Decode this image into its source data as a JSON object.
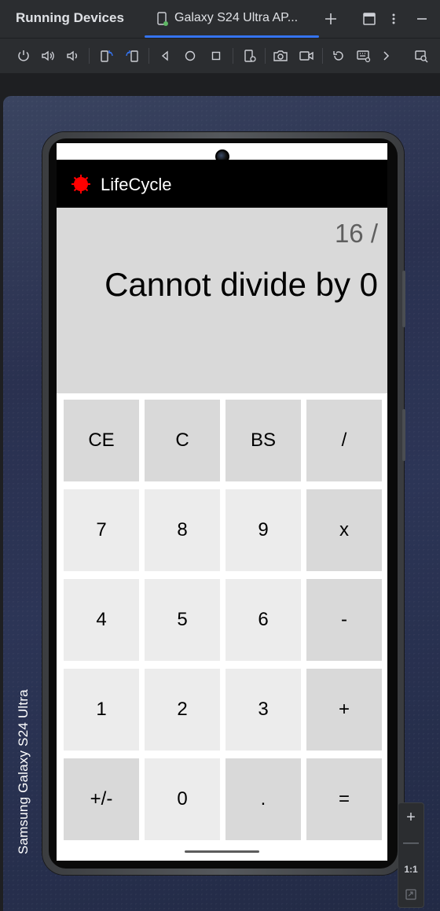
{
  "window": {
    "panel_title": "Running Devices",
    "device_tab_label": "Galaxy S24 Ultra AP..."
  },
  "toolbar": {
    "icons": [
      "power-icon",
      "volume-up-icon",
      "volume-down-icon",
      "rotate-left-icon",
      "rotate-right-icon",
      "back-icon",
      "home-icon",
      "overview-icon",
      "device-settings-icon",
      "screenshot-icon",
      "screen-record-icon",
      "snapshot-icon",
      "keyboard-icon",
      "more-chevron-icon",
      "device-explorer-icon"
    ]
  },
  "device": {
    "label": "Samsung Galaxy  S24 Ultra"
  },
  "app": {
    "title": "LifeCycle",
    "icon_color": "#ff0000",
    "expression": "16 /",
    "result": "Cannot divide by 0"
  },
  "keypad": {
    "rows": [
      [
        "CE",
        "C",
        "BS",
        "/"
      ],
      [
        "7",
        "8",
        "9",
        "x"
      ],
      [
        "4",
        "5",
        "6",
        "-"
      ],
      [
        "1",
        "2",
        "3",
        "+"
      ],
      [
        "+/-",
        "0",
        ".",
        "="
      ]
    ]
  },
  "zoom": {
    "zoom_in": "+",
    "zoom_out": "—",
    "actual_size": "1:1"
  },
  "colors": {
    "accent": "#3574f0",
    "key_dark": "#d9d9d9",
    "key_light": "#ececec",
    "display_bg": "#d9d9d9"
  }
}
